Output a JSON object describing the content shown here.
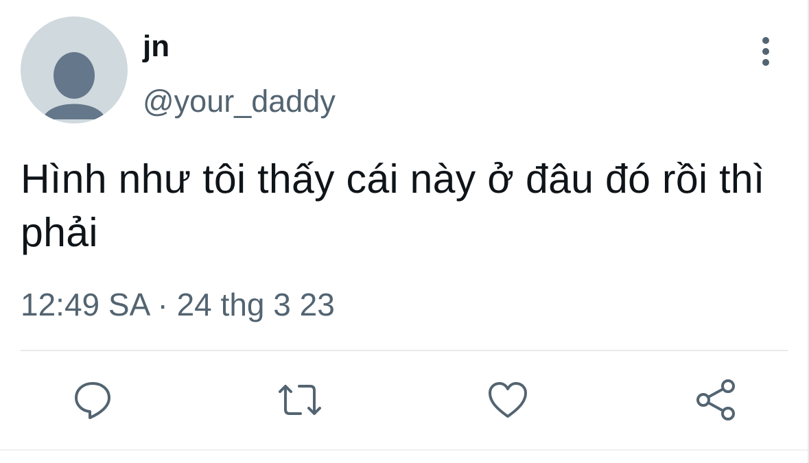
{
  "author": {
    "name": "jn",
    "handle": "@your_daddy"
  },
  "tweet": {
    "text": "Hình như tôi thấy cái này ở đâu đó rồi thì phải",
    "timestamp": "12:49 SA · 24 thg 3 23"
  },
  "actions": {
    "icons": [
      "reply-icon",
      "retweet-icon",
      "like-icon",
      "share-icon"
    ]
  },
  "colors": {
    "primary_text": "#0f1419",
    "secondary_text": "#536471",
    "avatar_bg": "#cfd9de",
    "avatar_fg": "#65778a",
    "divider": "#e7e9ea"
  }
}
